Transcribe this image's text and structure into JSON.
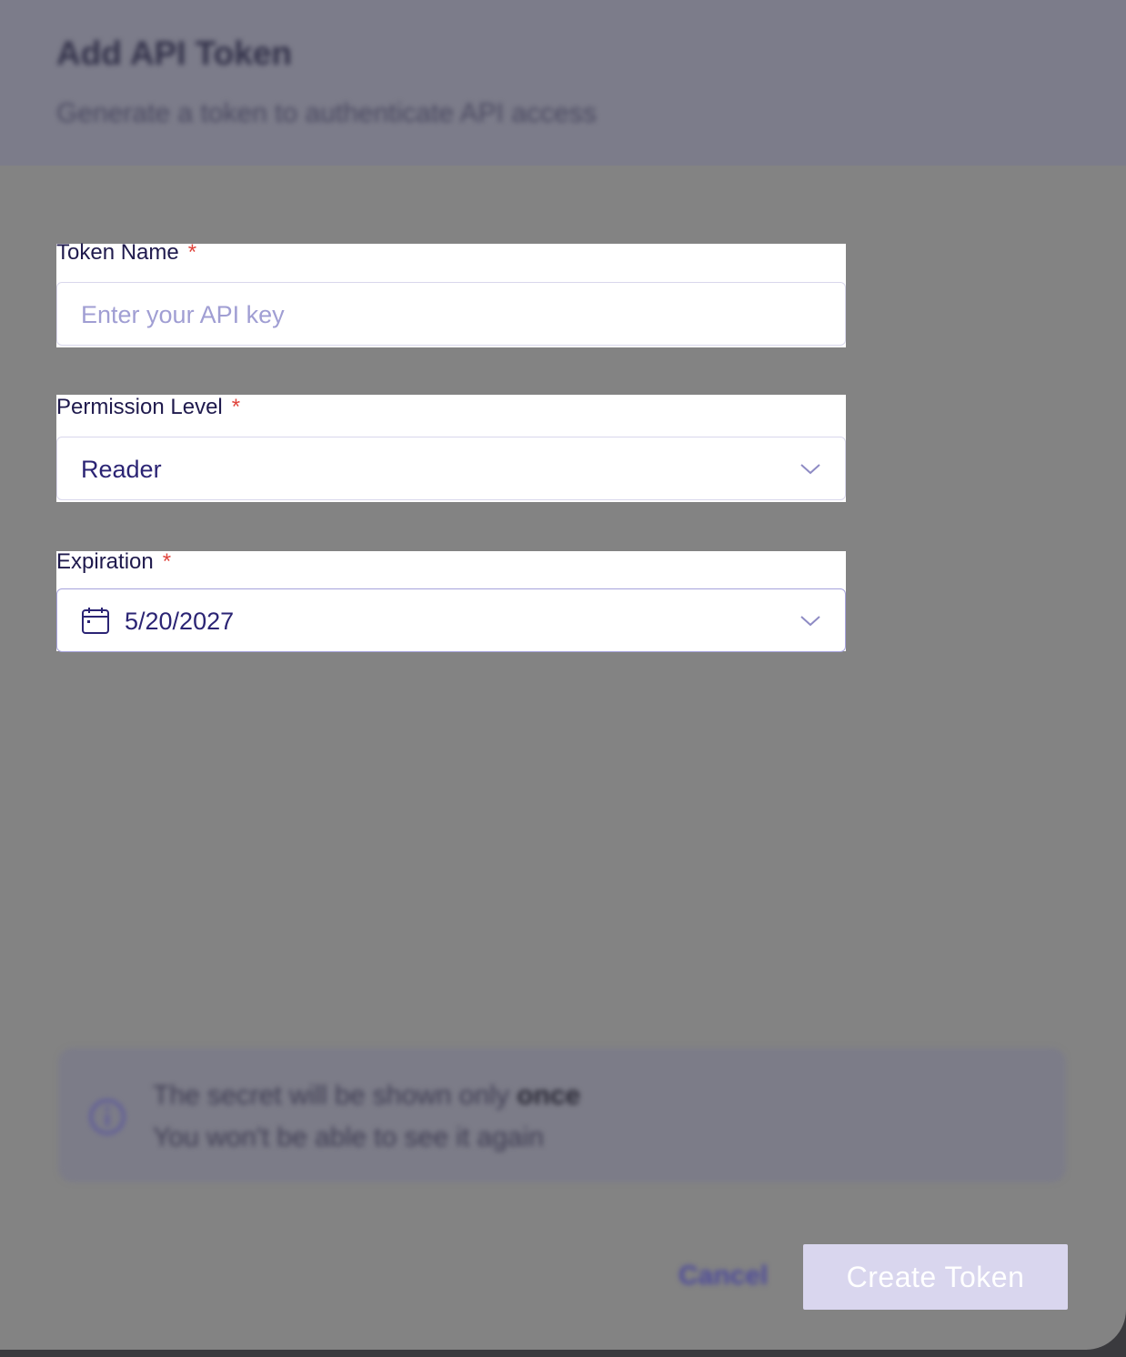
{
  "dialog": {
    "title": "Add API Token",
    "subtitle": "Generate a token to authenticate API access"
  },
  "form": {
    "token_name": {
      "label": "Token Name",
      "required_mark": "*",
      "placeholder": "Enter your API key",
      "value": ""
    },
    "permission_level": {
      "label": "Permission Level",
      "required_mark": "*",
      "selected": "Reader"
    },
    "expiration": {
      "label": "Expiration",
      "required_mark": "*",
      "date": "5/20/2027"
    }
  },
  "notice": {
    "line1_prefix": "The secret will be shown only ",
    "line1_emphasis": "once",
    "line2": "You won't be able to see it again"
  },
  "actions": {
    "cancel_label": "Cancel",
    "create_label": "Create Token"
  },
  "icons": {
    "chevron": "chevron-down-icon",
    "calendar": "calendar-icon",
    "info": "info-icon"
  },
  "colors": {
    "accent": "#2b2474",
    "required": "#e0443c",
    "placeholder": "#a09ed3",
    "primary_button_disabled": "#d9d6ee"
  }
}
